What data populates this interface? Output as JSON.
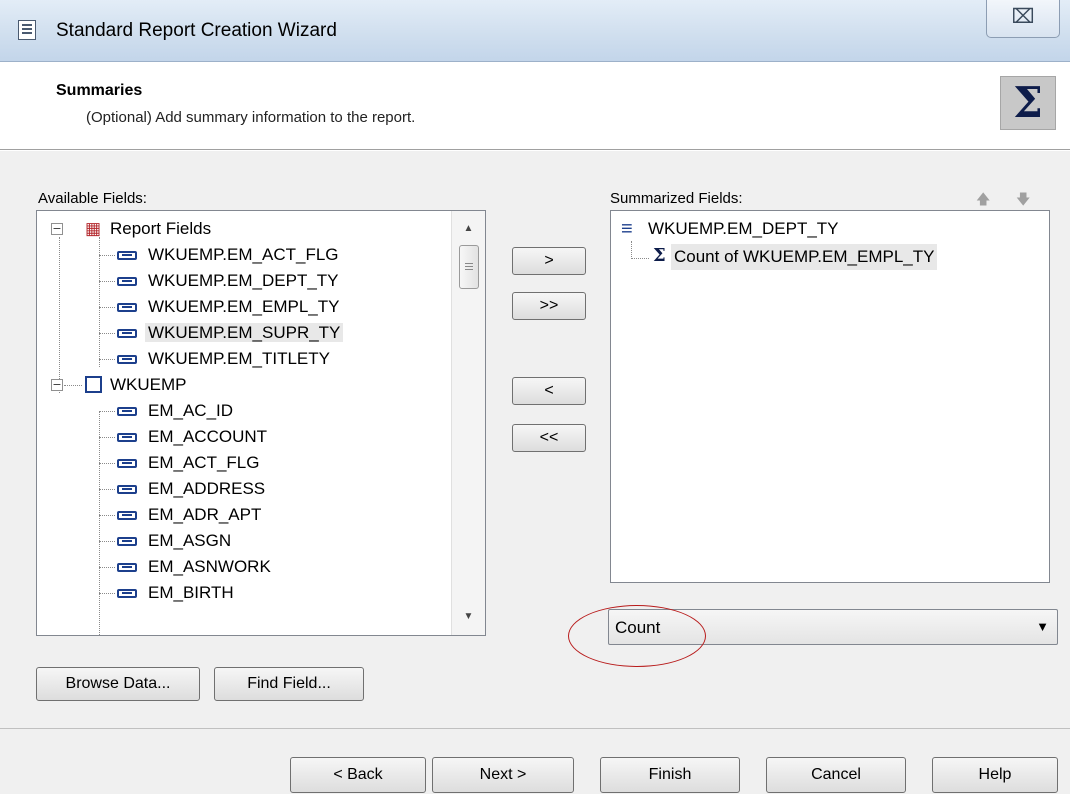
{
  "window": {
    "title": "Standard Report Creation Wizard",
    "close_glyph": "⌧"
  },
  "header": {
    "title": "Summaries",
    "subtitle": "(Optional) Add summary information to the report.",
    "icon": "Σ"
  },
  "available": {
    "label": "Available Fields:",
    "groups": [
      {
        "name": "Report Fields",
        "icon": "report-fields-icon",
        "items": [
          "WKUEMP.EM_ACT_FLG",
          "WKUEMP.EM_DEPT_TY",
          "WKUEMP.EM_EMPL_TY",
          "WKUEMP.EM_SUPR_TY",
          "WKUEMP.EM_TITLETY"
        ]
      },
      {
        "name": "WKUEMP",
        "icon": "table-icon",
        "items": [
          "EM_AC_ID",
          "EM_ACCOUNT",
          "EM_ACT_FLG",
          "EM_ADDRESS",
          "EM_ADR_APT",
          "EM_ASGN",
          "EM_ASNWORK",
          "EM_BIRTH"
        ]
      }
    ],
    "selected_item": "WKUEMP.EM_SUPR_TY"
  },
  "transfer_buttons": {
    "add": ">",
    "add_all": ">>",
    "remove": "<",
    "remove_all": "<<"
  },
  "summarized": {
    "label": "Summarized Fields:",
    "group": "WKUEMP.EM_DEPT_TY",
    "item": "Count of WKUEMP.EM_EMPL_TY"
  },
  "summary_type": {
    "selected": "Count"
  },
  "buttons": {
    "browse": "Browse Data...",
    "find": "Find Field...",
    "back": "< Back",
    "next": "Next >",
    "finish": "Finish",
    "cancel": "Cancel",
    "help": "Help"
  },
  "colors": {
    "annotation": "#b81c1c",
    "field_icon": "#1c3f8c"
  }
}
